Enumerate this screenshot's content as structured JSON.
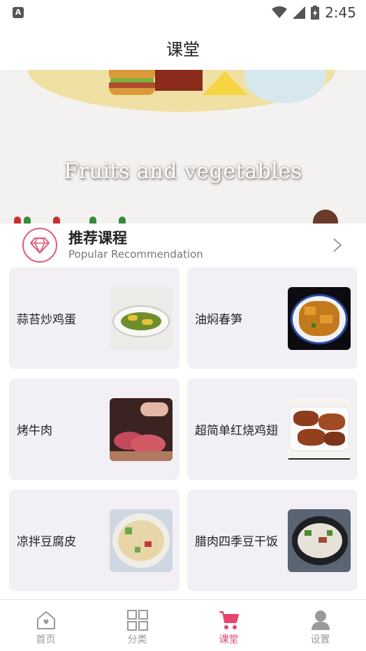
{
  "status_bar": {
    "notification_icon": "A",
    "time": "2:45",
    "icons": [
      "wifi-icon",
      "cellular-signal-icon",
      "battery-charging-icon"
    ]
  },
  "header": {
    "title": "课堂"
  },
  "banner": {
    "caption": "Fruits and vegetables"
  },
  "recommendation": {
    "title": "推荐课程",
    "subtitle": "Popular Recommendation",
    "icon": "diamond-icon",
    "accent_color": "#e05a7a"
  },
  "courses": [
    {
      "name": "蒜苔炒鸡蛋",
      "thumb": "garlic-sprout-egg-photo"
    },
    {
      "name": "油焖春笋",
      "thumb": "braised-bamboo-shoots-photo"
    },
    {
      "name": "烤牛肉",
      "thumb": "roast-beef-photo"
    },
    {
      "name": "超简单红烧鸡翅",
      "thumb": "braised-chicken-wings-photo"
    },
    {
      "name": "凉拌豆腐皮",
      "thumb": "tofu-skin-salad-photo"
    },
    {
      "name": "腊肉四季豆干饭",
      "thumb": "bacon-green-bean-rice-photo"
    }
  ],
  "tab_bar": {
    "active_color": "#e8436e",
    "inactive_color": "#9a9a9a",
    "tabs": [
      {
        "label": "首页",
        "icon": "home-icon",
        "active": false
      },
      {
        "label": "分类",
        "icon": "grid-icon",
        "active": false
      },
      {
        "label": "课堂",
        "icon": "cart-icon",
        "active": true
      },
      {
        "label": "设置",
        "icon": "user-icon",
        "active": false
      }
    ]
  }
}
